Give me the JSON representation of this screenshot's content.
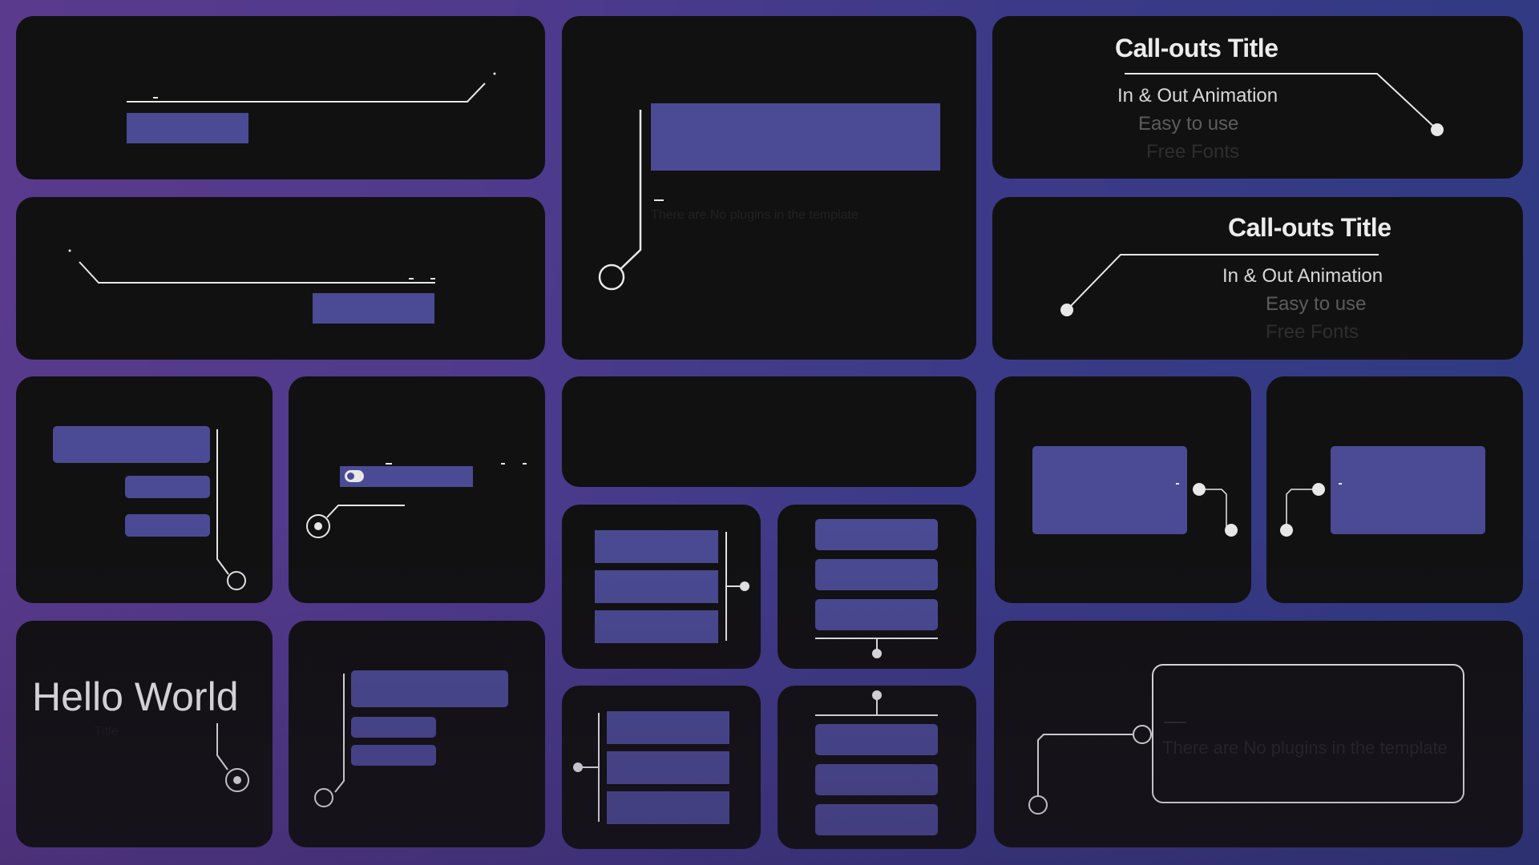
{
  "background": {
    "gradient_from": "#5a3a8c",
    "gradient_to": "#2e3a82"
  },
  "colors": {
    "card": "#111111",
    "block": "#4a4b94",
    "line": "#e8e8e8"
  },
  "callouts": [
    {
      "title": "Call-outs Title",
      "lines": [
        "In & Out Animation",
        "Easy to use",
        "Free Fonts"
      ],
      "pointer_side": "right"
    },
    {
      "title": "Call-outs Title",
      "lines": [
        "In & Out Animation",
        "Easy to use",
        "Free Fonts"
      ],
      "pointer_side": "left"
    }
  ],
  "center_callout": {
    "placeholder_text": "There are No plugins in the template"
  },
  "bottom_right_callout": {
    "placeholder_text": "There are No plugins in the template"
  },
  "hello_card": {
    "heading": "Hello World",
    "subtext": "Title"
  },
  "toggle": {
    "state": "off"
  }
}
